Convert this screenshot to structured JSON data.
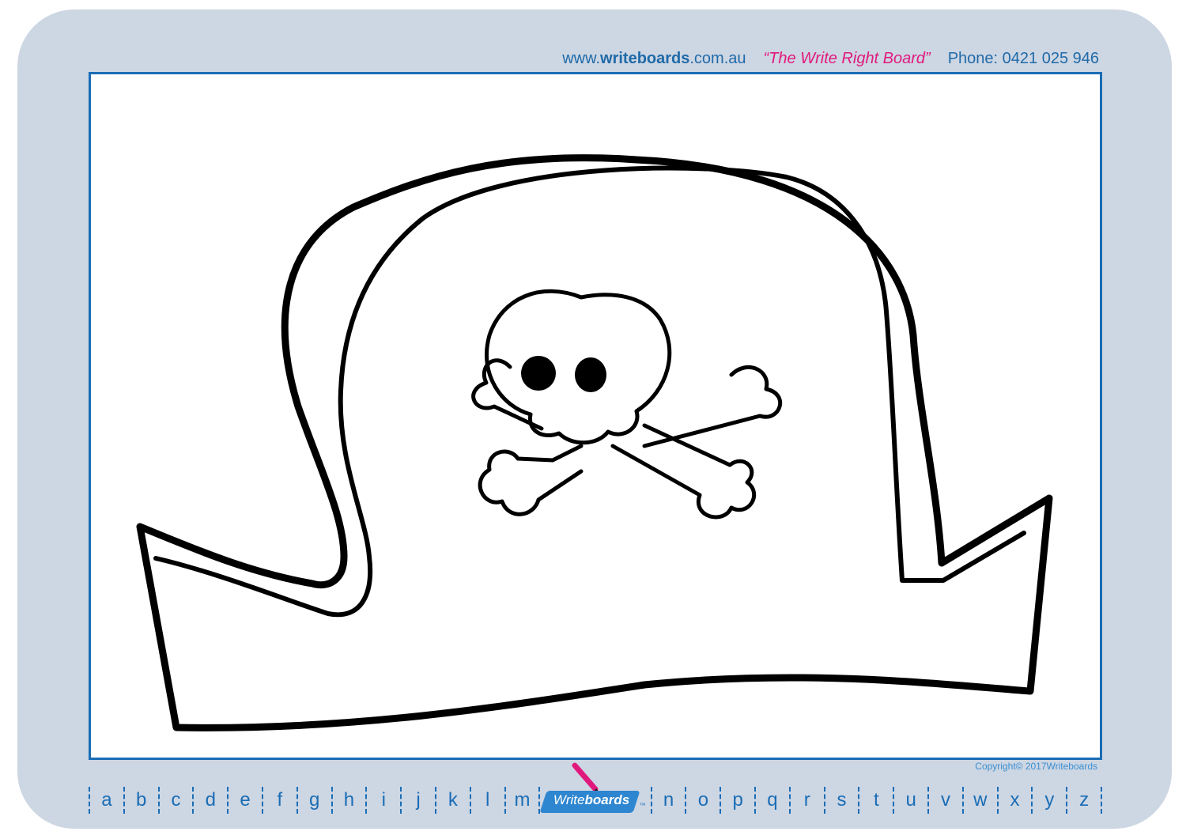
{
  "header": {
    "site_prefix": "www.",
    "site_bold": "writeboards",
    "site_suffix": ".com.au",
    "slogan": "“The Write Right Board”",
    "phone": "Phone: 0421 025 946"
  },
  "copyright": "Copyright© 2017Writeboards",
  "logo": {
    "pre": "Write",
    "bold": "boards",
    "tm": "™"
  },
  "alphabet_left": [
    "a",
    "b",
    "c",
    "d",
    "e",
    "f",
    "g",
    "h",
    "i",
    "j",
    "k",
    "l",
    "m"
  ],
  "alphabet_right": [
    "n",
    "o",
    "p",
    "q",
    "r",
    "s",
    "t",
    "u",
    "v",
    "w",
    "x",
    "y",
    "z"
  ],
  "colors": {
    "frame": "#cdd6e3",
    "border": "#1a6db5",
    "slogan": "#e0197d",
    "text": "#1f6aa8"
  },
  "drawing": {
    "subject": "pirate-hat-with-skull-and-crossbones"
  }
}
